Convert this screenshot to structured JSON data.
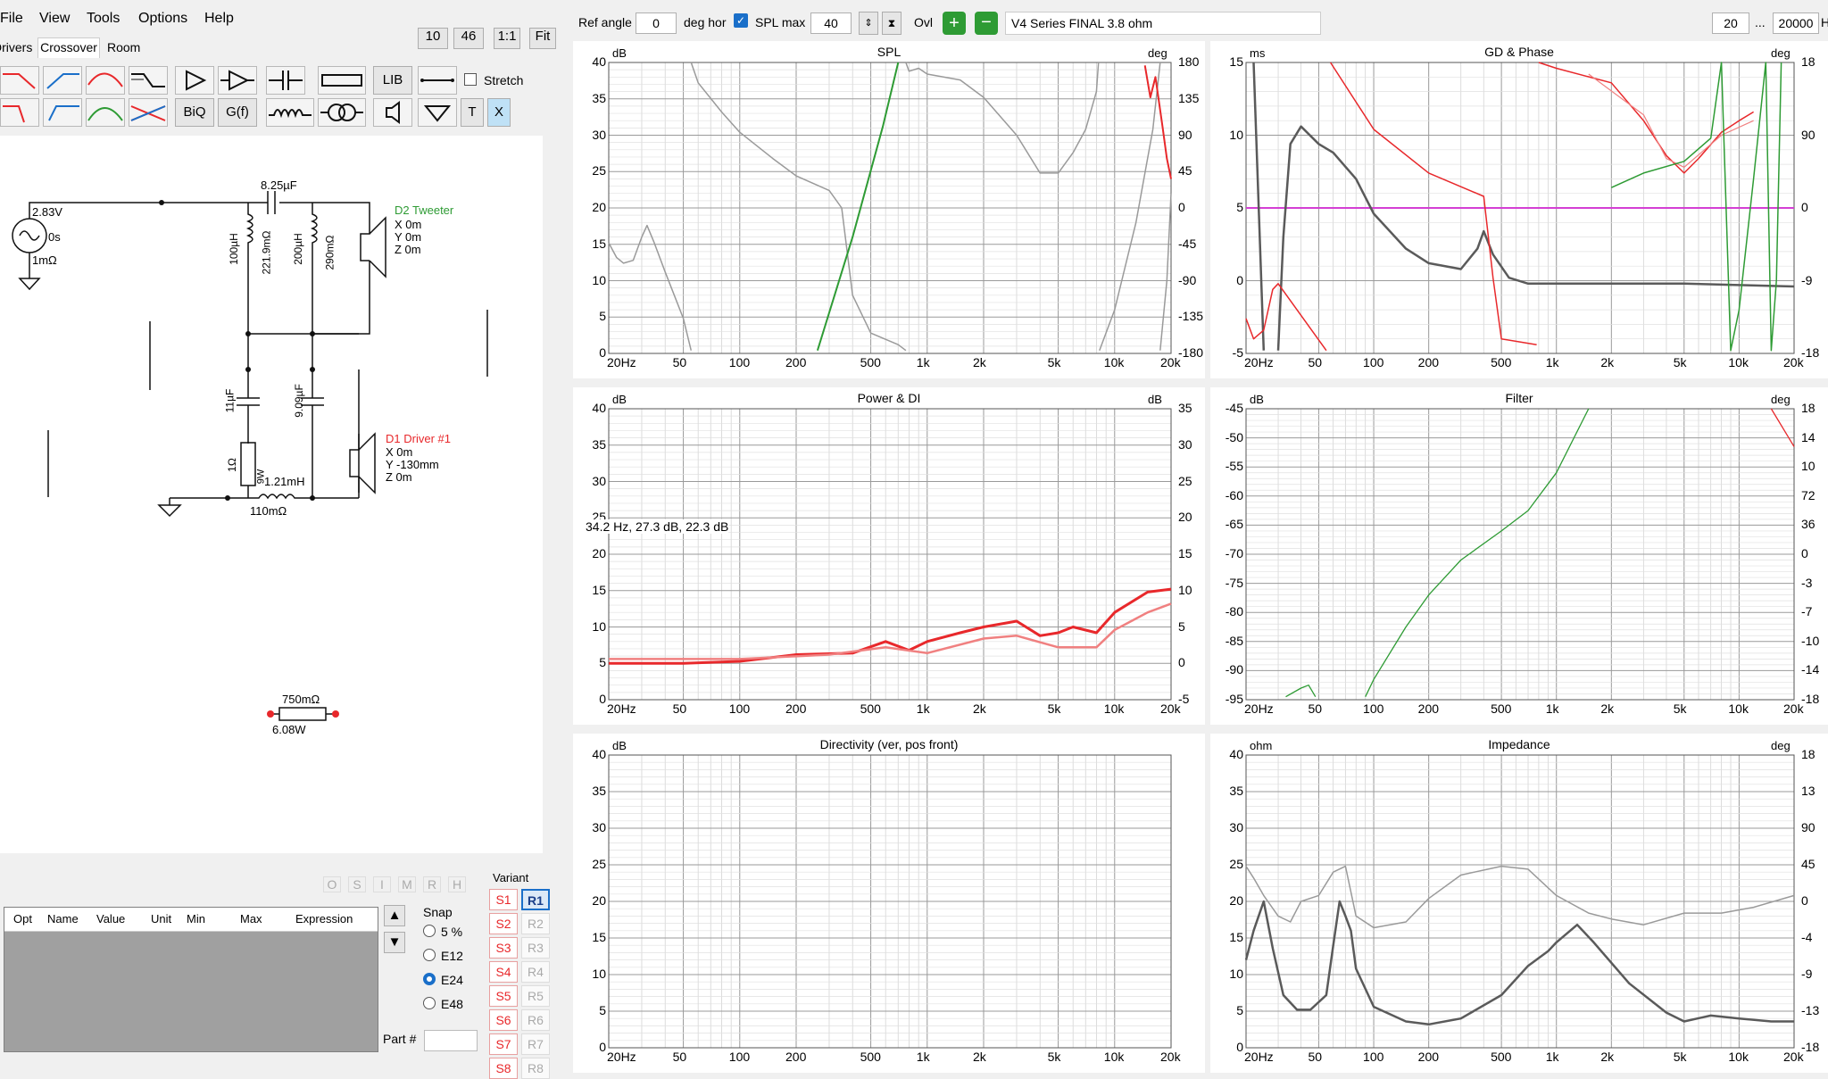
{
  "menu": {
    "file": "File",
    "view": "View",
    "tools": "Tools",
    "options": "Options",
    "help": "Help"
  },
  "tabs": {
    "drivers": "Drivers",
    "crossover": "Crossover",
    "room": "Room"
  },
  "zoom": {
    "a": "10",
    "b": "46",
    "one": "1:1",
    "fit": "Fit"
  },
  "toolbar": {
    "lib": "LIB",
    "stretch": "Stretch",
    "biq": "BiQ",
    "gf": "G(f)",
    "t": "T",
    "x": "X"
  },
  "top": {
    "ref_angle_label": "Ref angle",
    "ref_angle": "0",
    "deg_hor": "deg hor",
    "spl_max_label": "SPL max",
    "spl_max": "40",
    "ovl": "Ovl",
    "title": "V4 Series FINAL 3.8 ohm",
    "fmin": "20",
    "dots": "...",
    "fmax": "20000",
    "hz": "Hz"
  },
  "schematic": {
    "source_v": "2.83V",
    "source_t": "0s",
    "source_r": "1mΩ",
    "cap_top": "8.25µF",
    "ind1": "100µH",
    "ind1_r": "221.9mΩ",
    "ind2": "200µH",
    "ind2_r": "290mΩ",
    "tweeter_name": "D2 Tweeter",
    "tweeter_x": "X 0m",
    "tweeter_y": "Y 0m",
    "tweeter_z": "Z 0m",
    "cap2": "11µF",
    "cap3": "9.09µF",
    "res1": "1Ω",
    "res1_w": "9W",
    "ind3": "1.21mH",
    "ind3_r": "110mΩ",
    "driver_name": "D1 Driver #1",
    "driver_x": "X 0m",
    "driver_y": "Y -130mm",
    "driver_z": "Z 0m",
    "loose_r": "750mΩ",
    "loose_w": "6.08W"
  },
  "bottom": {
    "osimrh": [
      "O",
      "S",
      "I",
      "M",
      "R",
      "H"
    ],
    "cols": [
      "Opt",
      "Name",
      "Value",
      "Unit",
      "Min",
      "Max",
      "Expression"
    ],
    "snap": "Snap",
    "snap_opts": [
      "5 %",
      "E12",
      "E24",
      "E48"
    ],
    "snap_selected": "E24",
    "part": "Part #",
    "variant": "Variant",
    "s": [
      "S1",
      "S2",
      "S3",
      "S4",
      "S5",
      "S6",
      "S7",
      "S8"
    ],
    "r": [
      "R1",
      "R2",
      "R3",
      "R4",
      "R5",
      "R6",
      "R7",
      "R8"
    ]
  },
  "freq_ticks": [
    "20Hz",
    "50",
    "100",
    "200",
    "500",
    "1k",
    "2k",
    "5k",
    "10k",
    "20k"
  ],
  "colors": {
    "red": "#e8282b",
    "green": "#2e9b34",
    "grey": "#9a9a9a",
    "dark": "#5a5a5a",
    "magenta": "#d43fd4",
    "pink": "#f08080",
    "accent": "#1a6fc9"
  },
  "charts": {
    "spl": {
      "title": "SPL",
      "lunit": "dB",
      "runit": "deg",
      "left": [
        "40",
        "35",
        "30",
        "25",
        "20",
        "15",
        "10",
        "5",
        "0"
      ],
      "right": [
        "180",
        "135",
        "90",
        "45",
        "0",
        "-45",
        "-90",
        "-135",
        "-180"
      ]
    },
    "gd": {
      "title": "GD & Phase",
      "lunit": "ms",
      "runit": "deg",
      "left": [
        "15",
        "10",
        "5",
        "0",
        "-5"
      ],
      "right": [
        "18",
        "90",
        "0",
        "-9",
        "-18"
      ]
    },
    "power": {
      "title": "Power & DI",
      "lunit": "dB",
      "runit": "dB",
      "left": [
        "40",
        "35",
        "30",
        "25",
        "20",
        "15",
        "10",
        "5",
        "0"
      ],
      "right": [
        "35",
        "30",
        "25",
        "20",
        "15",
        "10",
        "5",
        "0",
        "-5"
      ],
      "readout": "34.2 Hz, 27.3 dB, 22.3 dB"
    },
    "filter": {
      "title": "Filter",
      "lunit": "dB",
      "runit": "deg",
      "left": [
        "-45",
        "-50",
        "-55",
        "-60",
        "-65",
        "-70",
        "-75",
        "-80",
        "-85",
        "-90",
        "-95"
      ],
      "right": [
        "18",
        "14",
        "10",
        "72",
        "36",
        "0",
        "-3",
        "-7",
        "-10",
        "-14",
        "-18"
      ]
    },
    "dir": {
      "title": "Directivity (ver, pos front)",
      "lunit": "dB",
      "left": [
        "40",
        "35",
        "30",
        "25",
        "20",
        "15",
        "10",
        "5",
        "0"
      ]
    },
    "imp": {
      "title": "Impedance",
      "lunit": "ohm",
      "runit": "deg",
      "left": [
        "40",
        "35",
        "30",
        "25",
        "20",
        "15",
        "10",
        "5",
        "0"
      ],
      "right": [
        "18",
        "13",
        "90",
        "45",
        "0",
        "-4",
        "-9",
        "-13",
        "-18"
      ]
    }
  }
}
